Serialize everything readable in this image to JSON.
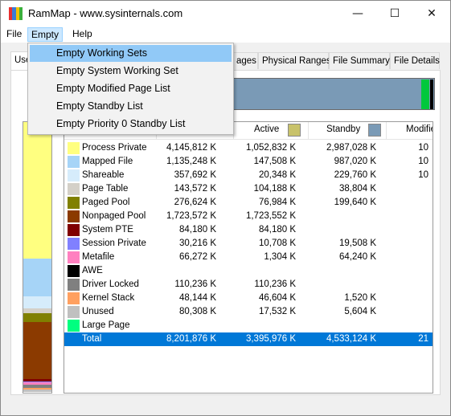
{
  "window": {
    "title": "RamMap - www.sysinternals.com",
    "minimize_glyph": "—",
    "maximize_glyph": "☐",
    "close_glyph": "✕"
  },
  "icon_colors": [
    "#e83030",
    "#3a7bd5",
    "#f2c200",
    "#3bb03b"
  ],
  "menubar": {
    "file": "File",
    "empty": "Empty",
    "help": "Help"
  },
  "dropdown": {
    "items": [
      "Empty Working Sets",
      "Empty System Working Set",
      "Empty Modified Page List",
      "Empty Standby List",
      "Empty Priority 0 Standby List"
    ],
    "highlighted_index": 0
  },
  "tabs": {
    "partial_first": "Use",
    "partial_hidden": "ages",
    "physical_ranges": "Physical Ranges",
    "file_summary": "File Summary",
    "file_details": "File Details"
  },
  "grid": {
    "headers": {
      "active": "Active",
      "standby": "Standby",
      "modified": "Modifie"
    },
    "header_colors": {
      "active": "#c8c26a",
      "standby": "#7a9ab6"
    },
    "rows": [
      {
        "label": "Process Private",
        "color": "#ffff80",
        "total": "4,145,812 K",
        "active": "1,052,832 K",
        "standby": "2,987,028 K",
        "modified": "10"
      },
      {
        "label": "Mapped File",
        "color": "#a6d4f7",
        "total": "1,135,248 K",
        "active": "147,508 K",
        "standby": "987,020 K",
        "modified": "10"
      },
      {
        "label": "Shareable",
        "color": "#d6ecfb",
        "total": "357,692 K",
        "active": "20,348 K",
        "standby": "229,760 K",
        "modified": "10"
      },
      {
        "label": "Page Table",
        "color": "#d4d0c8",
        "total": "143,572 K",
        "active": "104,188 K",
        "standby": "38,804 K",
        "modified": ""
      },
      {
        "label": "Paged Pool",
        "color": "#808000",
        "total": "276,624 K",
        "active": "76,984 K",
        "standby": "199,640 K",
        "modified": ""
      },
      {
        "label": "Nonpaged Pool",
        "color": "#8b3a00",
        "total": "1,723,572 K",
        "active": "1,723,552 K",
        "standby": "",
        "modified": ""
      },
      {
        "label": "System PTE",
        "color": "#800000",
        "total": "84,180 K",
        "active": "84,180 K",
        "standby": "",
        "modified": ""
      },
      {
        "label": "Session Private",
        "color": "#8080ff",
        "total": "30,216 K",
        "active": "10,708 K",
        "standby": "19,508 K",
        "modified": ""
      },
      {
        "label": "Metafile",
        "color": "#ff80c0",
        "total": "66,272 K",
        "active": "1,304 K",
        "standby": "64,240 K",
        "modified": ""
      },
      {
        "label": "AWE",
        "color": "#000000",
        "total": "",
        "active": "",
        "standby": "",
        "modified": ""
      },
      {
        "label": "Driver Locked",
        "color": "#808080",
        "total": "110,236 K",
        "active": "110,236 K",
        "standby": "",
        "modified": ""
      },
      {
        "label": "Kernel Stack",
        "color": "#ffa060",
        "total": "48,144 K",
        "active": "46,604 K",
        "standby": "1,520 K",
        "modified": ""
      },
      {
        "label": "Unused",
        "color": "#c0c0c0",
        "total": "80,308 K",
        "active": "17,532 K",
        "standby": "5,604 K",
        "modified": ""
      },
      {
        "label": "Large Page",
        "color": "#00ff80",
        "total": "",
        "active": "",
        "standby": "",
        "modified": ""
      }
    ],
    "total_row": {
      "label": "Total",
      "total": "8,201,876 K",
      "active": "3,395,976 K",
      "standby": "4,533,124 K",
      "modified": "21"
    }
  },
  "topbar_colors": {
    "standby": "#7a9ab6",
    "green": "#00c83c",
    "black": "#000000"
  },
  "sidebar_segments": [
    {
      "color": "#ffff80",
      "fraction": 0.505
    },
    {
      "color": "#a6d4f7",
      "fraction": 0.138
    },
    {
      "color": "#d6ecfb",
      "fraction": 0.044
    },
    {
      "color": "#d4d0c8",
      "fraction": 0.018
    },
    {
      "color": "#808000",
      "fraction": 0.034
    },
    {
      "color": "#8b3a00",
      "fraction": 0.21
    },
    {
      "color": "#800000",
      "fraction": 0.01
    },
    {
      "color": "#8080ff",
      "fraction": 0.004
    },
    {
      "color": "#ff80c0",
      "fraction": 0.008
    },
    {
      "color": "#808080",
      "fraction": 0.013
    },
    {
      "color": "#ffa060",
      "fraction": 0.006
    },
    {
      "color": "#c0c0c0",
      "fraction": 0.01
    }
  ]
}
